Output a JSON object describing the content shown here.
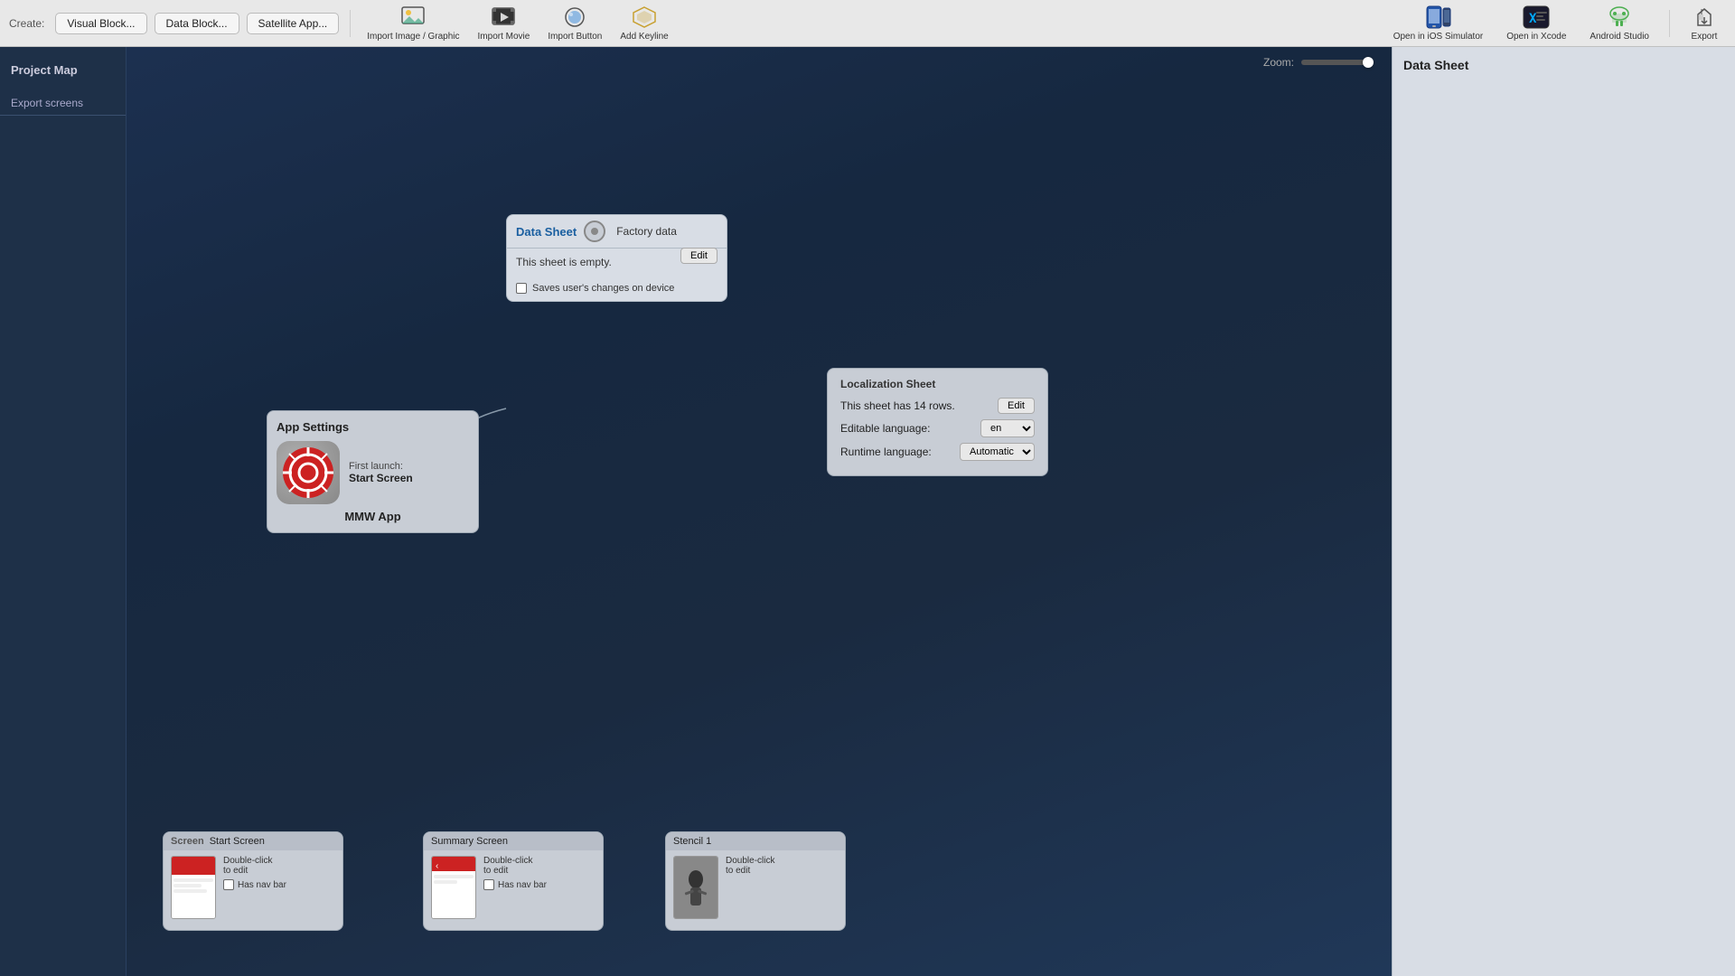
{
  "toolbar": {
    "create_label": "Create:",
    "visual_block_btn": "Visual Block...",
    "data_block_btn": "Data Block...",
    "satellite_app_btn": "Satellite App...",
    "import_image_btn": "Import Image / Graphic",
    "import_movie_btn": "Import Movie",
    "import_button_btn": "Import Button",
    "add_keyline_btn": "Add Keyline",
    "open_ios_btn": "Open in iOS Simulator",
    "open_xcode_btn": "Open in Xcode",
    "android_studio_btn": "Android Studio",
    "export_btn": "Export"
  },
  "sidebar": {
    "project_map_label": "Project Map",
    "export_screens_label": "Export screens"
  },
  "canvas": {
    "zoom_label": "Zoom:"
  },
  "data_sheet_card": {
    "title": "Data Sheet",
    "factory_data": "Factory data",
    "empty_text": "This sheet is empty.",
    "edit_btn": "Edit",
    "saves_text": "Saves user's changes on device"
  },
  "localization_card": {
    "title": "Localization Sheet",
    "rows_text": "This sheet has 14 rows.",
    "edit_btn": "Edit",
    "editable_language_label": "Editable language:",
    "editable_language_value": "en",
    "runtime_language_label": "Runtime language:",
    "runtime_language_value": "Automatic"
  },
  "app_settings_card": {
    "title": "App Settings",
    "first_launch_label": "First launch:",
    "start_screen_label": "Start Screen",
    "app_name": "MMW App"
  },
  "right_panel": {
    "title": "Data Sheet"
  },
  "screen_start": {
    "header_label": "Screen",
    "title": "Start Screen",
    "double_click": "Double-click\nto edit",
    "has_nav_bar": "Has nav bar"
  },
  "screen_summary": {
    "title": "Summary Screen",
    "double_click": "Double-click\nto edit",
    "has_nav_bar": "Has nav bar"
  },
  "screen_stencil": {
    "title": "Stencil 1",
    "double_click": "Double-click\nto edit"
  }
}
